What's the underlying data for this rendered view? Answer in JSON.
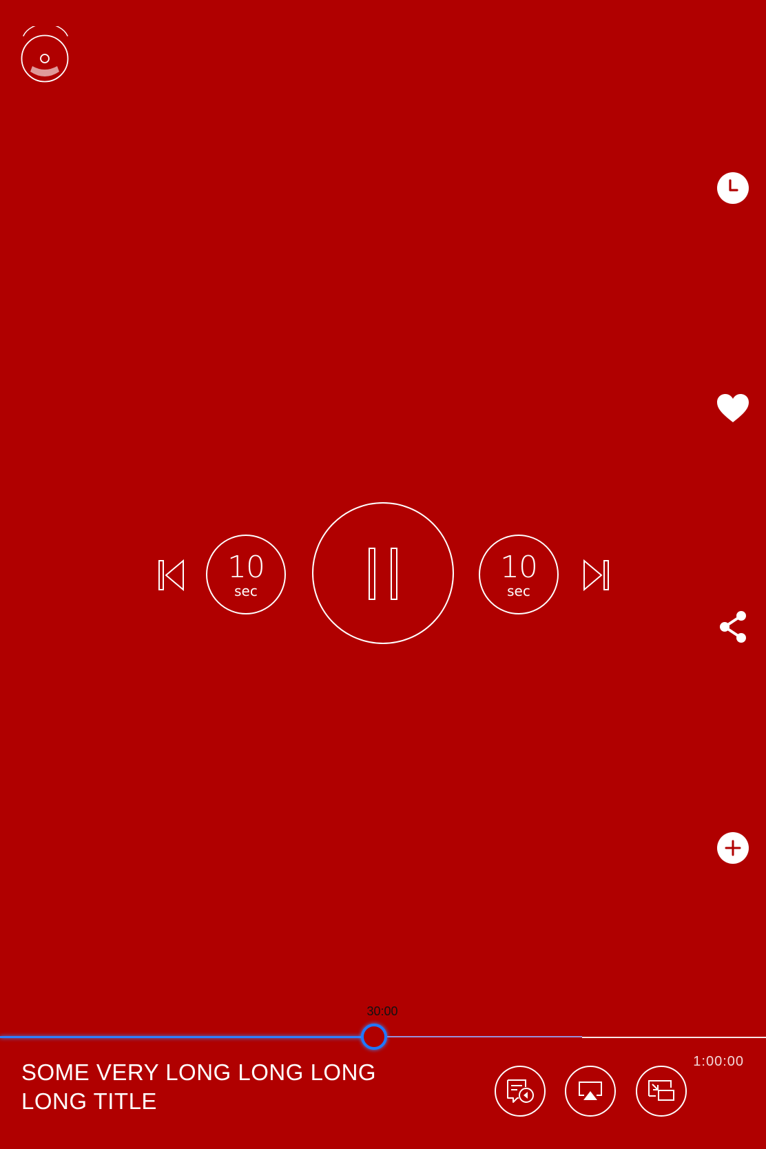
{
  "app": {
    "logo_icon": "radio-logo-icon"
  },
  "side_actions": [
    {
      "icon": "clock-icon"
    },
    {
      "icon": "heart-icon"
    },
    {
      "icon": "share-icon"
    },
    {
      "icon": "plus-icon"
    }
  ],
  "controls": {
    "skip_back": {
      "value": "10",
      "unit": "sec"
    },
    "skip_forward": {
      "value": "10",
      "unit": "sec"
    },
    "state": "playing"
  },
  "progress": {
    "current_time": "30:00",
    "total_time": "1:00:00",
    "played_fraction": 0.5,
    "buffered_fraction": 0.76
  },
  "track": {
    "title": "SOME VERY LONG LONG LONG LONG TITLE"
  },
  "bottom_actions": [
    {
      "icon": "cast-queue-icon"
    },
    {
      "icon": "airplay-icon"
    },
    {
      "icon": "picture-in-picture-icon"
    }
  ],
  "colors": {
    "background": "#b00000",
    "accent": "#1f78ff",
    "foreground": "#ffffff"
  }
}
